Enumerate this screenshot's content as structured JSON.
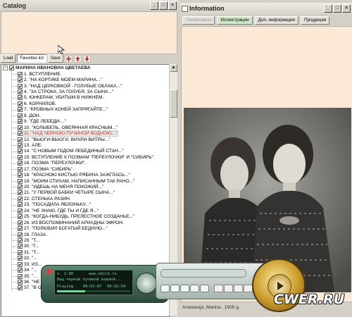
{
  "catalog": {
    "title": "Catalog",
    "toolbar": {
      "load": "Load",
      "favorites": "Favorites list",
      "save": "Save"
    },
    "root_label": "МАРИНА ИВАНОВНА ЦВЕТАЕВА",
    "items": [
      "1. ВСТУПЛЕНИЕ.",
      "2. \"НА КОРТИКЕ МОЕМ МАРИНА...\"",
      "3. \"НАД ЦЕРКОВКОЙ - ГОЛУБЫЕ ОБЛАКА...\"",
      "4. \"ЗА СТРОКА, ЗА ГОЛУБЯ, ЗА СЫНА...\"",
      "5. ЮНКЕРАМ, УБИТЫМ В НИЖНЕМ.",
      "6. КОРНИЛОВ.",
      "7. \"КРОВНЫХ КОНЕЙ ЗАПРЯГАЙТЕ...\"",
      "8. ДОН.",
      "9. \"ГДЕ ЛЕБЕДИ-...\"",
      "10. \"КОЛЫБЕЛЬ, ОВЕЯННАЯ КРАСНЫМ...\"",
      "11. \"НАД ЧЕРНОЮ ПУЧИНОЙ ВОДНОЮ...\"",
      "12. \"ВЬЮГИ-ВЬЮГИ, ВИХРИ-ВИТРЫ...\"",
      "13. АЛЕ.",
      "14. \"С НОВЫМ ГОДОМ ЛЕБЕДИНЫЙ СТАН...\"",
      "15. ВСТУПЛЕНИЕ К ПОЭМАМ \"ПЕРЕУЛОЧКИ\" И \"СИБИРЬ\".",
      "16. ПОЭМА \"ПЕРЕУЛОЧКИ\".",
      "17. ПОЭМА \"СИБИРЬ\".",
      "18. \"КРАСНОЮ КИСТЬЮ РЯБИНА ЗАЖГЛАСЬ...\"",
      "19. \"МОИМ СТИХАМ, НАПИСАННЫМ ТАК РАНО...\"",
      "20. \"ИДЕШЬ НА МЕНЯ ПОХОЖИЙ...\"",
      "21. \"У ПЕРВОЙ БАБКИ ЧЕТЫРЕ СЫНА...\"",
      "22. СТЕНЬКА РАЗИН.",
      "23. \"ПОСАДИЛА ЯБЛОНЬКУ...\"",
      "24. \"НЕ ЗНАЮ, ГДЕ ТЫ И ГДЕ Я...\"",
      "25. \"КОГДА-НИБУДЬ, ПРЕЛЕСТНОЕ СОЗДАНЬЕ...\"",
      "26. ИЗ ВОСПОМИНАНИЙ АРИАДНЫ ЭФРОН.",
      "27. \"ПОЛЮБИЛ БОГАТЫЙ БЕДНУЮ...\"",
      "28. ГЛАЗА.",
      "29. \"Т...",
      "30. \"Г...",
      "31. \"Т...",
      "32. \"...",
      "33. ИЗ...",
      "34. \"...",
      "35. \"...",
      "36. \"НЕ ОТСТАТЬ ТЕБЕ...\"",
      "37. \"В ОГРОМНОМ ГОРОДЕ..."
    ],
    "selected_index": 10
  },
  "info": {
    "title": "Information",
    "tabs": [
      "Примечания",
      "Иллюстрации",
      "Доп. информация",
      "Продукция"
    ],
    "active_tab": 1,
    "caption": "Anastasija ,Marina , 1905 g."
  },
  "player": {
    "version": "v. 2.00",
    "url": "www.zdslk.ru",
    "track": "Над черною пучиной водной...",
    "status": "Playing",
    "time": "00:01:07",
    "total": "00:02:54"
  },
  "watermark": "CWER.RU",
  "colors": {
    "beige": "#fbe9d6",
    "selected_text": "#c0392b",
    "player_green": "#2d4a3d"
  }
}
